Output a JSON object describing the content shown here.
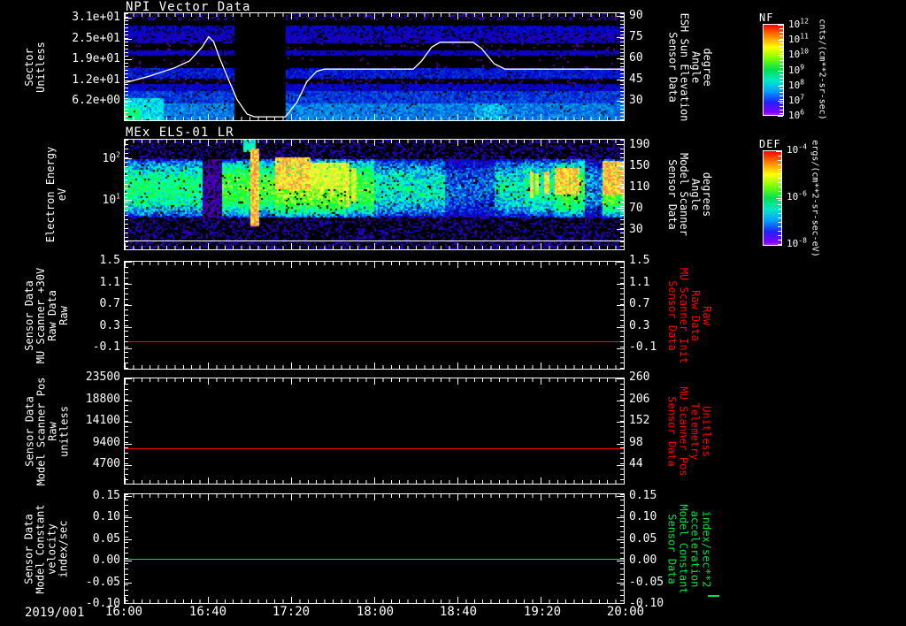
{
  "panels": [
    {
      "title": "NPI Vector Data",
      "left_label": [
        "Sector",
        "Unitless"
      ],
      "left_ticks": [
        "3.1e+01",
        "2.5e+01",
        "1.9e+01",
        "1.2e+01",
        "6.2e+00"
      ],
      "right_ticks": [
        "90",
        "75",
        "60",
        "45",
        "30"
      ],
      "right_label": [
        "Sensor Data",
        "ESH Sun Elevation",
        "Angle",
        "degree"
      ],
      "colorbar": {
        "title": "NF",
        "tick_exponents": [
          "12",
          "11",
          "10",
          "9",
          "8",
          "7",
          "6"
        ],
        "units": "cnts/(cm**2-sr-sec)"
      }
    },
    {
      "title": "MEx ELS-01 LR",
      "left_label": [
        "Electron Energy",
        "eV"
      ],
      "left_tick_exponents": [
        "2",
        "1"
      ],
      "right_ticks": [
        "190",
        "150",
        "110",
        "70",
        "30"
      ],
      "right_label": [
        "Sensor Data",
        "Model Scanner",
        "Angle",
        "degrees"
      ],
      "colorbar": {
        "title": "DEF",
        "tick_exponents": [
          "-4",
          "-6",
          "-8"
        ],
        "units": "ergs/(cm**2-sr-sec-eV)"
      }
    },
    {
      "left_label": [
        "Sensor Data",
        "MU Scanner +30V",
        "Raw Data",
        "Raw"
      ],
      "left_ticks": [
        "1.5",
        "1.1",
        "0.7",
        "0.3",
        "-0.1"
      ],
      "right_ticks": [
        "1.5",
        "1.1",
        "0.7",
        "0.3",
        "-0.1"
      ],
      "right_label": [
        "Sensor Data",
        "MU Scanner Init",
        "Raw Data",
        "Raw"
      ]
    },
    {
      "left_label": [
        "Sensor Data",
        "Model Scanner Pos",
        "Raw",
        "unitless"
      ],
      "left_ticks": [
        "23500",
        "18800",
        "14100",
        "9400",
        "4700"
      ],
      "right_ticks": [
        "260",
        "206",
        "152",
        "98",
        "44"
      ],
      "right_label": [
        "Sensor Data",
        "MU Scanner Pos",
        "Telemetry",
        "Unitless"
      ]
    },
    {
      "left_label": [
        "Sensor Data",
        "Model Constant",
        "velocity",
        "index/sec"
      ],
      "left_ticks": [
        "0.15",
        "0.10",
        "0.05",
        "0.00",
        "-0.05",
        "-0.10"
      ],
      "right_ticks": [
        "0.15",
        "0.10",
        "0.05",
        "0.00",
        "-0.05",
        "-0.10"
      ],
      "right_label": [
        "Sensor Data",
        "Model Constant",
        "acceleration",
        "index/sec**2"
      ]
    }
  ],
  "time_axis": {
    "date": "2019/001",
    "ticks": [
      "16:00",
      "16:40",
      "17:20",
      "18:00",
      "18:40",
      "19:20",
      "20:00"
    ]
  },
  "colors": {
    "red_series": "#ff0000",
    "green_series": "#00e241",
    "frame": "#ffffff",
    "background": "#000000"
  },
  "chart_data": [
    {
      "type": "heatmap",
      "title": "NPI Vector Data",
      "ylabel": "Sector (Unitless)",
      "y_ticks": [
        31,
        25,
        19,
        12,
        6.2
      ],
      "x_range": [
        "2019/001 16:00",
        "2019/001 20:00"
      ],
      "legend": "NF colorbar 1e6 to 1e12 cnts/(cm**2-sr-sec)",
      "bands": [
        [
          0,
          0.06,
          0.2,
          0.25
        ],
        [
          0.06,
          0.105,
          0,
          0
        ],
        [
          0.105,
          0.175,
          0.3,
          0.8
        ],
        [
          0.175,
          0.27,
          0.26,
          0.8
        ],
        [
          0.27,
          0.345,
          0.05,
          0.12
        ],
        [
          0.345,
          0.39,
          0.28,
          0.9
        ],
        [
          0.39,
          0.5,
          0.04,
          0.1
        ],
        [
          0.5,
          0.6,
          0.34,
          0.95
        ],
        [
          0.6,
          0.645,
          0.06,
          0.2
        ],
        [
          0.645,
          0.72,
          0.3,
          0.9
        ],
        [
          0.72,
          0.83,
          0.38,
          0.95
        ],
        [
          0.83,
          1,
          0.44,
          0.97
        ]
      ],
      "gap_x": [
        0.217,
        0.322
      ],
      "hotspots": [
        [
          0,
          0.075,
          0.78,
          1,
          0.52
        ],
        [
          0.7,
          0.765,
          0.84,
          1,
          0.48
        ],
        [
          0,
          0.03,
          0.86,
          1,
          0.6
        ]
      ],
      "sun_curve": {
        "name": "ESH Sun Elevation Angle (deg)",
        "yrange_deg": [
          15,
          92.5
        ],
        "points": [
          [
            0,
            42
          ],
          [
            0.05,
            47
          ],
          [
            0.1,
            53
          ],
          [
            0.13,
            58
          ],
          [
            0.155,
            68
          ],
          [
            0.168,
            75.5
          ],
          [
            0.178,
            72
          ],
          [
            0.19,
            60
          ],
          [
            0.205,
            47
          ],
          [
            0.225,
            30
          ],
          [
            0.245,
            19.5
          ],
          [
            0.26,
            17.5
          ],
          [
            0.322,
            17.5
          ],
          [
            0.345,
            28
          ],
          [
            0.365,
            43
          ],
          [
            0.385,
            50.5
          ],
          [
            0.4,
            52
          ],
          [
            0.578,
            52
          ],
          [
            0.595,
            58
          ],
          [
            0.615,
            68
          ],
          [
            0.632,
            71.5
          ],
          [
            0.698,
            71.5
          ],
          [
            0.715,
            67
          ],
          [
            0.74,
            56
          ],
          [
            0.762,
            52
          ],
          [
            1,
            52
          ]
        ]
      }
    },
    {
      "type": "heatmap",
      "title": "MEx ELS-01 LR",
      "ylabel": "Electron Energy (eV), log scale 10^1-10^2 ticks",
      "legend": "DEF colorbar 1e-8 to 1e-4 ergs/(cm**2-sr-sec-eV)",
      "band_y": [
        0.17,
        0.7
      ],
      "profile": [
        [
          0,
          0.155,
          0.62
        ],
        [
          0.155,
          0.195,
          0.14
        ],
        [
          0.195,
          0.3,
          0.7
        ],
        [
          0.3,
          0.44,
          0.78
        ],
        [
          0.44,
          0.5,
          0.7
        ],
        [
          0.5,
          0.64,
          0.56
        ],
        [
          0.64,
          0.74,
          0.42
        ],
        [
          0.74,
          0.8,
          0.55
        ],
        [
          0.8,
          0.86,
          0.6
        ],
        [
          0.86,
          0.92,
          0.7
        ],
        [
          0.92,
          0.955,
          0.46
        ],
        [
          0.955,
          1,
          0.74
        ]
      ],
      "hot": [
        [
          0.3,
          0.37,
          0.15,
          0.45,
          0.88
        ],
        [
          0.37,
          0.44,
          0.2,
          0.45,
          0.82
        ],
        [
          0.86,
          0.91,
          0.25,
          0.5,
          0.88
        ],
        [
          0.955,
          1,
          0.18,
          0.5,
          0.9
        ],
        [
          0.235,
          0.262,
          0,
          0.1,
          0.55
        ]
      ],
      "streaks": [
        [
          0.258,
          0.008,
          0.08,
          0.78,
          0.97
        ],
        [
          0.445,
          0.005,
          0.2,
          0.6,
          0.92
        ],
        [
          0.457,
          0.004,
          0.25,
          0.55,
          0.9
        ],
        [
          0.813,
          0.004,
          0.28,
          0.52,
          0.92
        ],
        [
          0.825,
          0.004,
          0.3,
          0.5,
          0.9
        ],
        [
          0.843,
          0.005,
          0.28,
          0.5,
          0.93
        ]
      ]
    },
    {
      "type": "line",
      "series": "MU Scanner +30V Raw Data",
      "value": 0.0,
      "panel_yrange": [
        -0.5,
        1.5
      ],
      "color": "#ff0000"
    },
    {
      "type": "line",
      "series": "Model Scanner Pos Raw",
      "value": 7800,
      "right_equivalent": 86,
      "panel_yrange": [
        0,
        23500
      ],
      "color": "#ff0000"
    },
    {
      "type": "line",
      "series": "Model Constant velocity",
      "value": 0.0,
      "panel_yrange": [
        -0.102,
        0.156
      ],
      "color": "#00e241"
    }
  ]
}
